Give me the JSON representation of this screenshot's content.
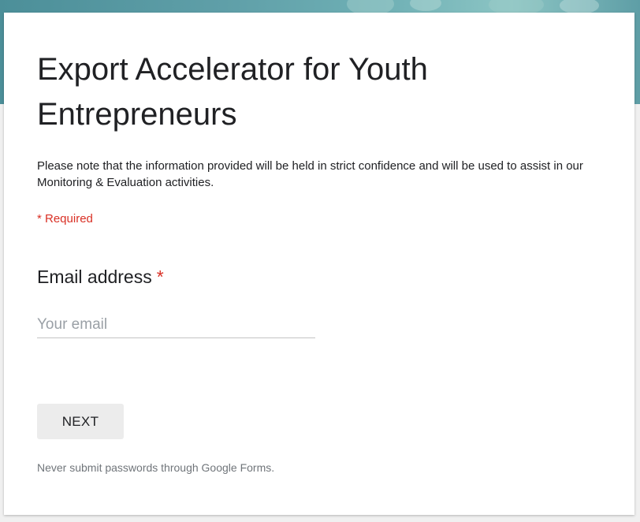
{
  "form": {
    "title": "Export Accelerator for Youth Entrepreneurs",
    "description": "Please note that the information provided will be held in strict confidence and will be used to assist in our Monitoring & Evaluation activities.",
    "required_note": "* Required"
  },
  "question": {
    "label": "Email address",
    "required_marker": "*",
    "placeholder": "Your email",
    "value": ""
  },
  "actions": {
    "next_label": "NEXT"
  },
  "footer": {
    "note": "Never submit passwords through Google Forms."
  },
  "colors": {
    "accent_required": "#d93025",
    "header_banner": "#5f9fa8",
    "button_bg": "#ececec"
  }
}
